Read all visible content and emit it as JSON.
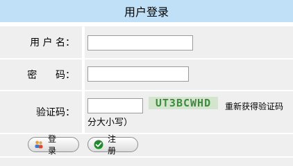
{
  "header": {
    "title": "用户登录"
  },
  "form": {
    "username_label": "用 户 名：",
    "password_label": "密      码：",
    "captcha_label": "验证码：",
    "username_value": "",
    "password_value": "",
    "captcha_value": "",
    "captcha_image_text": "UT3BCWHD",
    "refresh_link": "重新获得验证码",
    "hint": "分大小写）"
  },
  "actions": {
    "login_label": "登 录",
    "register_label": "注 册"
  },
  "colors": {
    "header_bg": "#bfe0f7",
    "cell_bg": "#efefef",
    "captcha_text": "#3e8a3e",
    "captcha_bg": "#d3e5cd"
  }
}
